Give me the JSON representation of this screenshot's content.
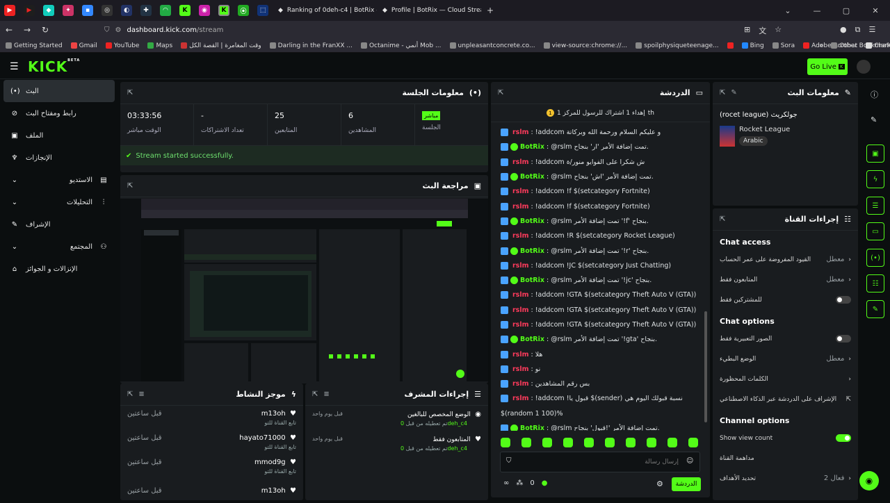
{
  "browser": {
    "tabs": [
      {
        "title": "Ranking of 0deh-c4 | BotRix —"
      },
      {
        "title": "Profile | BotRix — Cloud Stream"
      }
    ],
    "url_host": "dashboard.kick.com",
    "url_path": "/stream",
    "bookmarks": [
      "Getting Started",
      "Gmail",
      "YouTube",
      "Maps",
      "وقت المغامرة | القصة الكل",
      "Darling in the FranXX ...",
      "Octanime - أنمي Mob ...",
      "unpleasantconcrete.co...",
      "view-source:chrome://...",
      "spoilphysiqueteenage...",
      "Bing",
      "Sora",
      "Adobe Acrobat",
      "ChatGPT"
    ],
    "other_bookmarks": "Other Bookmarks"
  },
  "header": {
    "logo": "KICK",
    "beta": "BETA",
    "go_live": "Go Live"
  },
  "sidebar": {
    "items": [
      {
        "label": "البث"
      },
      {
        "label": "رابط ومفتاح البث"
      },
      {
        "label": "الملف"
      },
      {
        "label": "الإنجازات"
      },
      {
        "label": "الاستديو"
      },
      {
        "label": "التحليلات"
      },
      {
        "label": "الإشراف"
      },
      {
        "label": "المجتمع"
      },
      {
        "label": "الإنزالات و الجوائز"
      }
    ]
  },
  "session": {
    "title": "معلومات الجلسة",
    "live_badge": "مباشر",
    "stats": [
      {
        "value": "03:33:56",
        "label": "الوقت مباشر"
      },
      {
        "value": "-",
        "label": "تعداد الاشتراكات"
      },
      {
        "value": "25",
        "label": "المتابعين"
      },
      {
        "value": "6",
        "label": "المشاهدين"
      },
      {
        "value": "",
        "label": "الجلسة"
      }
    ],
    "success": "Stream started successfully."
  },
  "preview": {
    "title": "مراجعة البث"
  },
  "activity": {
    "title": "موجز النشاط",
    "items": [
      {
        "name": "m13oh",
        "sub": "تابع القناة للتو",
        "time": "قبل ساعتين"
      },
      {
        "name": "hayato71000",
        "sub": "تابع القناة للتو",
        "time": "قبل ساعتين"
      },
      {
        "name": "mmod9g",
        "sub": "تابع القناة للتو",
        "time": "قبل ساعتين"
      },
      {
        "name": "m13oh",
        "sub": "",
        "time": "قبل ساعتين"
      }
    ]
  },
  "modactions": {
    "title": "إجراءات المشرف",
    "items": [
      {
        "title": "الوضع المخصص للبالغين",
        "sub": "تم تعطيله من قبل",
        "user": "0deh_c4",
        "time": "قبل يوم واحد"
      },
      {
        "title": "المتابعون فقط",
        "sub": "تم تعطيله من قبل",
        "user": "0deh_c4",
        "time": "قبل يوم واحد"
      }
    ]
  },
  "chat": {
    "title": "الدردشة",
    "pinned": "إهداء 1 اشتراك للرسول للمركز 1",
    "pinned_user": "th",
    "messages": [
      {
        "user": "rslm",
        "badge": "sq",
        "text": "!addcom و عليكم السلام ورحمة الله وبركاتة"
      },
      {
        "user": "BotRix",
        "badge": "g",
        "text": "@rslm تمت إضافة الأمر 'ار' بنجاح."
      },
      {
        "user": "rslm",
        "badge": "sq",
        "text": "!addcom ش شكرا على الفوايو منور/ة"
      },
      {
        "user": "BotRix",
        "badge": "g",
        "text": "@rslm تمت إضافة الأمر 'اش' بنجاح."
      },
      {
        "user": "rslm",
        "badge": "sq",
        "text": "!addcom !f $(setcategory Fortnite)"
      },
      {
        "user": "rslm",
        "badge": "sq",
        "text": "!addcom !f $(setcategory Fortnite)"
      },
      {
        "user": "BotRix",
        "badge": "g",
        "text": "@rslm تمت إضافة الأمر '!f' بنجاح."
      },
      {
        "user": "rslm",
        "badge": "sq",
        "text": "!addcom !R $(setcategory Rocket League)"
      },
      {
        "user": "BotRix",
        "badge": "g",
        "text": "@rslm تمت إضافة الأمر '!r' بنجاح."
      },
      {
        "user": "rslm",
        "badge": "sq",
        "text": "!addcom !JC $(setcategory Just Chatting)"
      },
      {
        "user": "BotRix",
        "badge": "g",
        "text": "@rslm تمت إضافة الأمر '!jc' بنجاح."
      },
      {
        "user": "rslm",
        "badge": "sq",
        "text": "!addcom !GTA $(setcategory Theft Auto V (GTA))"
      },
      {
        "user": "rslm",
        "badge": "sq",
        "text": "!addcom !GTA $(setcategory Theft Auto V (GTA))"
      },
      {
        "user": "rslm",
        "badge": "sq",
        "text": "!addcom !GTA $(setcategory Theft Auto V (GTA))"
      },
      {
        "user": "BotRix",
        "badge": "g",
        "text": "@rslm تمت إضافة الأمر '!gta' بنجاح."
      },
      {
        "user": "rslm",
        "badge": "sq",
        "text": "هلا"
      },
      {
        "user": "rslm",
        "badge": "sq",
        "text": "نو"
      },
      {
        "user": "rslm",
        "badge": "sq",
        "text": "بس رقم المشاهدين"
      },
      {
        "user": "rslm",
        "badge": "sq",
        "text": "!addcom !قبول يا $(sender) نسبة قبولك اليوم هي"
      },
      {
        "user": "",
        "badge": "",
        "text": "$(random 1 100)%"
      },
      {
        "user": "BotRix",
        "badge": "g",
        "text": "@rslm تمت إضافة الأمر '!قبول' بنجاح."
      }
    ],
    "input_placeholder": "إرسال رسالة",
    "count": "0",
    "send": "الدردشة"
  },
  "streaminfo": {
    "title": "معلومات البث",
    "stream_title": "(rocet league) جولكريث",
    "category": "Rocket League",
    "language": "Arabic"
  },
  "channelactions": {
    "title": "إجراءات القناة",
    "chat_access": "Chat access",
    "access_rows": [
      {
        "label": "القيود المفروضة على عمر الحساب",
        "value": "معطل"
      },
      {
        "label": "المتابعون فقط",
        "value": "معطل"
      },
      {
        "label": "للمشتركين فقط",
        "value": ""
      }
    ],
    "chat_options": "Chat options",
    "option_rows": [
      {
        "label": "الصور التعبيرية فقط",
        "value": ""
      },
      {
        "label": "الوضع البطيء",
        "value": "معطل"
      },
      {
        "label": "الكلمات المحظورة",
        "value": ""
      },
      {
        "label": "الإشراف على الدردشة عبر الذكاء الاصطناعي",
        "value": ""
      }
    ],
    "channel_options": "Channel options",
    "show_view_count": "Show view count",
    "watch_channel": "مداهمة القناة",
    "goals": "تحديد الأهداف",
    "goals_val": "فعال 2"
  }
}
